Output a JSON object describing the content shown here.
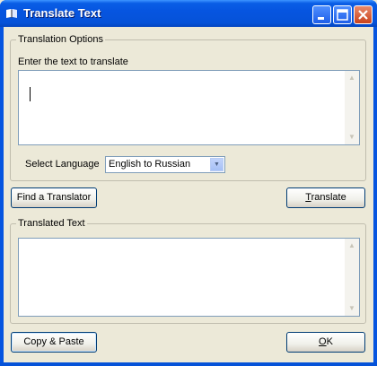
{
  "window": {
    "title": "Translate Text"
  },
  "options_group": {
    "legend": "Translation Options",
    "input_label": "Enter the text to translate",
    "input_value": "",
    "language_label": "Select Language",
    "language_selected": "English to Russian"
  },
  "buttons": {
    "find_translator": "Find a Translator",
    "translate_prefix": "T",
    "translate_rest": "ranslate",
    "copy_paste": "Copy & Paste",
    "ok_prefix": "O",
    "ok_rest": "K"
  },
  "output_group": {
    "legend": "Translated Text",
    "output_value": ""
  },
  "colors": {
    "titlebar_blue": "#0655e0",
    "dialog_bg": "#ece9d8",
    "border_blue": "#7f9db9"
  }
}
